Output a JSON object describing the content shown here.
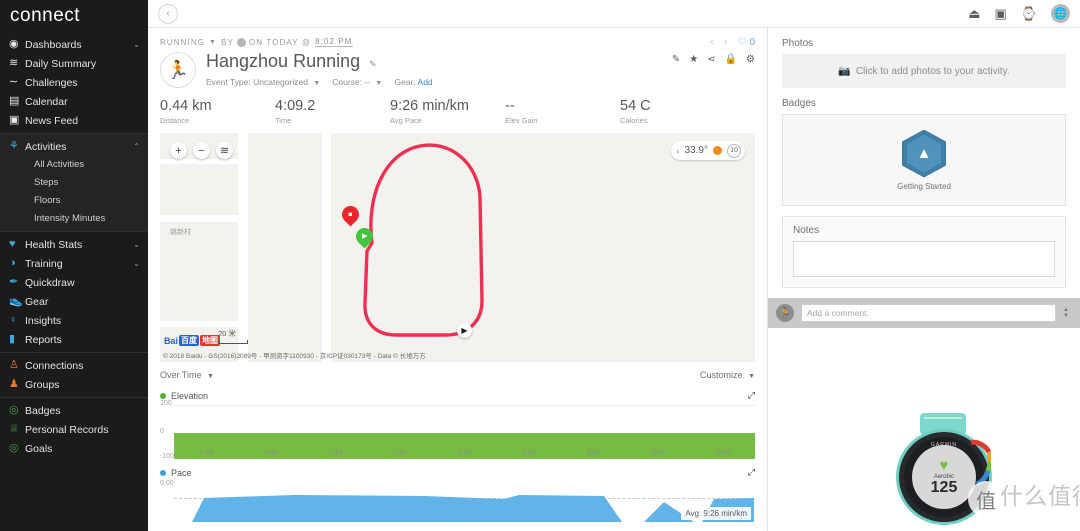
{
  "brand": {
    "name": "connect"
  },
  "sidebar": {
    "groups": [
      {
        "items": [
          {
            "label": "Dashboards",
            "icon": "speedometer-icon",
            "glyph": "◉",
            "color": "i-white",
            "chevron": "⌄"
          },
          {
            "label": "Daily Summary",
            "icon": "layers-icon",
            "glyph": "≋",
            "color": "i-white",
            "chevron": ""
          },
          {
            "label": "Challenges",
            "icon": "wave-icon",
            "glyph": "∼",
            "color": "i-white",
            "chevron": ""
          },
          {
            "label": "Calendar",
            "icon": "calendar-icon",
            "glyph": "▤",
            "color": "i-white",
            "chevron": ""
          },
          {
            "label": "News Feed",
            "icon": "newspaper-icon",
            "glyph": "▣",
            "color": "i-white",
            "chevron": ""
          }
        ]
      },
      {
        "active": true,
        "items": [
          {
            "label": "Activities",
            "icon": "running-person-icon",
            "glyph": "⚘",
            "color": "i-blue",
            "chevron": "⌃"
          }
        ],
        "sub": [
          "All Activities",
          "Steps",
          "Floors",
          "Intensity Minutes"
        ]
      },
      {
        "items": [
          {
            "label": "Health Stats",
            "icon": "heart-icon",
            "glyph": "♥",
            "color": "i-blue",
            "chevron": "⌄"
          },
          {
            "label": "Training",
            "icon": "stopwatch-icon",
            "glyph": "◑",
            "color": "i-blue",
            "chevron": "⌄"
          },
          {
            "label": "Quickdraw",
            "icon": "pen-icon",
            "glyph": "✒",
            "color": "i-blue",
            "chevron": ""
          },
          {
            "label": "Gear",
            "icon": "shoe-icon",
            "glyph": "👟",
            "color": "i-blue",
            "chevron": ""
          },
          {
            "label": "Insights",
            "icon": "lightbulb-icon",
            "glyph": "♀",
            "color": "i-blue",
            "chevron": ""
          },
          {
            "label": "Reports",
            "icon": "bar-chart-icon",
            "glyph": "▮",
            "color": "i-blue",
            "chevron": ""
          }
        ]
      },
      {
        "items": [
          {
            "label": "Connections",
            "icon": "people-icon",
            "glyph": "♙",
            "color": "i-orange",
            "chevron": ""
          },
          {
            "label": "Groups",
            "icon": "group-icon",
            "glyph": "♟",
            "color": "i-orange",
            "chevron": ""
          }
        ]
      },
      {
        "items": [
          {
            "label": "Badges",
            "icon": "badge-icon",
            "glyph": "◎",
            "color": "i-green",
            "chevron": ""
          },
          {
            "label": "Personal Records",
            "icon": "trophy-icon",
            "glyph": "♕",
            "color": "i-green",
            "chevron": ""
          },
          {
            "label": "Goals",
            "icon": "target-icon",
            "glyph": "◎",
            "color": "i-green",
            "chevron": ""
          }
        ]
      }
    ]
  },
  "topbar": {
    "back_icon": "‹",
    "icons": [
      {
        "name": "upload-cloud-icon",
        "glyph": "⏏"
      },
      {
        "name": "inbox-icon",
        "glyph": "▣"
      },
      {
        "name": "watch-device-icon",
        "glyph": "⌚"
      }
    ],
    "avatar": "🌐"
  },
  "activity": {
    "type_label": "RUNNING",
    "by_label": "BY",
    "on_label": "ON TODAY @",
    "time": "8:02 PM",
    "title": "Hangzhou Running",
    "event_type_label": "Event Type:",
    "event_type_value": "Uncategorized",
    "course_label": "Course:",
    "course_value": "--",
    "gear_label": "Gear:",
    "gear_link": "Add",
    "like_count": "0",
    "tools": [
      "pencil-icon",
      "star-icon",
      "share-icon",
      "lock-icon",
      "gear-icon"
    ],
    "tool_glyphs": [
      "✎",
      "★",
      "⋖",
      "🔒",
      "⚙"
    ],
    "stats": [
      {
        "value": "0.44 km",
        "label": "Distance"
      },
      {
        "value": "4:09.2",
        "label": "Time"
      },
      {
        "value": "9:26 min/km",
        "label": "Avg Pace"
      },
      {
        "value": "--",
        "label": "Elev Gain"
      },
      {
        "value": "54 C",
        "label": "Calories"
      }
    ]
  },
  "map": {
    "zoom_in": "+",
    "zoom_out": "−",
    "layers_icon": "≋",
    "weather_temp": "33.9°",
    "weather_condition_icon": "sun-icon",
    "weather_count": "10",
    "place_label": "姚新村",
    "provider_b": "Bai",
    "provider_paw": "百度",
    "provider_map": "地图",
    "scale": "20 米",
    "attribution": "© 2018 Baidu - GS(2016)2089号 - 甲测资字1100930 - 京ICP证030173号 - Data © 长地万方"
  },
  "charts_header": {
    "left": "Over Time",
    "right": "Customize"
  },
  "chart_data": [
    {
      "type": "area",
      "title": "Elevation",
      "series_color": "#76bc43",
      "xlabel": "",
      "ylabel": "",
      "ylim": [
        -100,
        100
      ],
      "yticks": [
        "100",
        "0",
        "-100"
      ],
      "xticks": [
        "0:25",
        "0:50",
        "1:15",
        "1:40",
        "2:05",
        "2:30",
        "2:55",
        "3:20",
        "3:45"
      ],
      "x": [
        "0:25",
        "0:50",
        "1:15",
        "1:40",
        "2:05",
        "2:30",
        "2:55",
        "3:20",
        "3:45"
      ],
      "values": [
        0,
        0,
        0,
        0,
        0,
        0,
        0,
        0,
        0
      ],
      "grid": true,
      "legend": "Elevation"
    },
    {
      "type": "area",
      "title": "Pace",
      "series_color": "#62b4e8",
      "xlabel": "",
      "ylabel": "",
      "yticks": [
        "0:00"
      ],
      "x": [
        0,
        1,
        2,
        3,
        4,
        5,
        6,
        7,
        8,
        9,
        10,
        11,
        12
      ],
      "values": [
        0,
        92,
        96,
        96,
        95,
        95,
        90,
        96,
        95,
        0,
        60,
        10,
        88
      ],
      "annotation": "Avg: 9:26 min/km",
      "legend": "Pace"
    }
  ],
  "right_panel": {
    "photos_label": "Photos",
    "photos_cta": "Click to add photos to your activity.",
    "photos_icon": "camera-icon",
    "badges_label": "Badges",
    "badge_name": "Getting Started",
    "notes_label": "Notes",
    "notes_value": "",
    "comment_placeholder": "Add a comment."
  },
  "watch_photo": {
    "brand": "GARMIN",
    "zone": "Aerobic",
    "heart_rate": "125",
    "watermark_text": "什么值得买",
    "watermark_logo": "值"
  }
}
